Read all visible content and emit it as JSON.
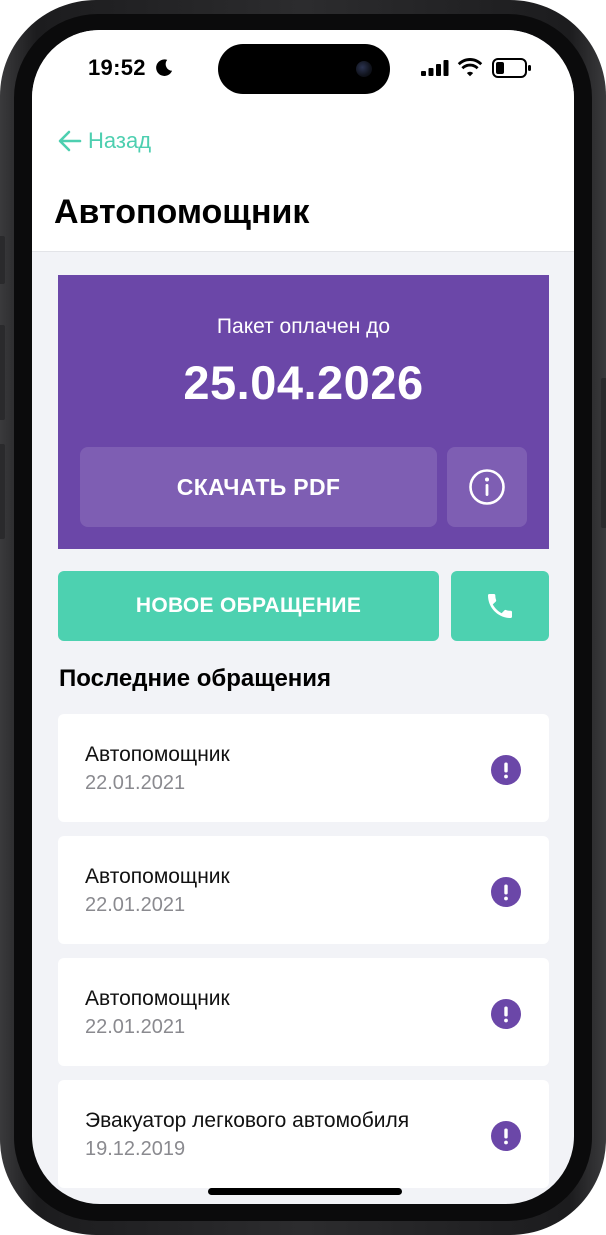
{
  "status_bar": {
    "time": "19:52"
  },
  "nav": {
    "back_label": "Назад"
  },
  "page": {
    "title": "Автопомощник"
  },
  "package": {
    "label": "Пакет оплачен до",
    "date": "25.04.2026",
    "pdf_button": "СКАЧАТЬ PDF"
  },
  "actions": {
    "new_request": "НОВОЕ ОБРАЩЕНИЕ"
  },
  "requests": {
    "section_title": "Последние обращения",
    "items": [
      {
        "title": "Автопомощник",
        "date": "22.01.2021"
      },
      {
        "title": "Автопомощник",
        "date": "22.01.2021"
      },
      {
        "title": "Автопомощник",
        "date": "22.01.2021"
      },
      {
        "title": "Эвакуатор легкового автомобиля",
        "date": "19.12.2019"
      }
    ]
  },
  "colors": {
    "accent_green": "#4dd1b0",
    "package_purple": "#6b47a8",
    "alert_purple": "#6b47a8",
    "background": "#f2f3f7"
  },
  "icons": [
    "moon-icon",
    "signal-icon",
    "wifi-icon",
    "battery-icon",
    "back-arrow-icon",
    "info-icon",
    "phone-icon",
    "exclamation-icon"
  ]
}
